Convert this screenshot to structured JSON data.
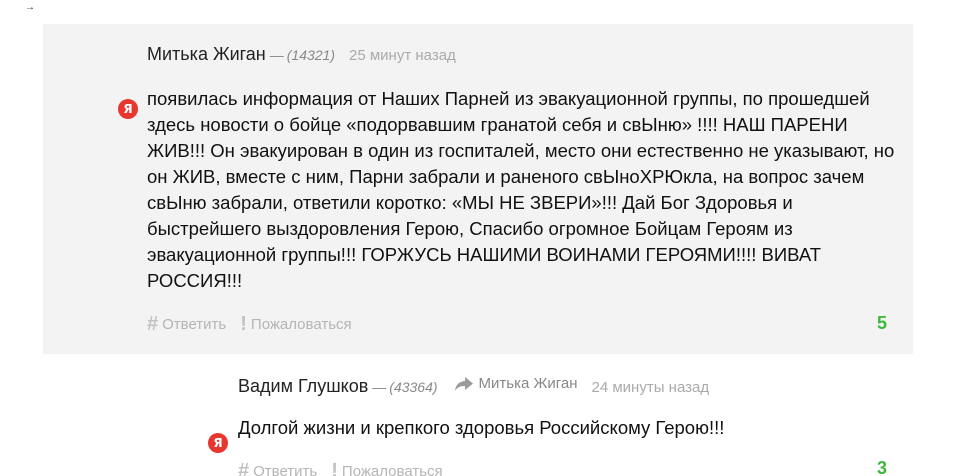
{
  "comment1": {
    "author": "Митька Жиган",
    "dash": "—",
    "karma": "(14321)",
    "time": "25 минут назад",
    "badge_letter": "Я",
    "badge_color": "#e8362f",
    "text": "  появилась информация от Наших Парней из эвакуационной группы, по прошедшей здесь новости о бойце «подорвавшим гранатой себя и свЫню» !!!! НАШ ПАРЕНИ ЖИВ!!! Он эвакуирован в один из госпиталей, место они естественно не указывают, но он ЖИВ, вместе с ним, Парни забрали и раненого свЫноХРЮкла, на вопрос зачем свЫню забрали, ответили коротко: «МЫ НЕ ЗВЕРИ»!!! Дай Бог Здоровья и быстрейшего выздоровления Герою, Спасибо огромное Бойцам Героям из эвакуационной группы!!! ГОРЖУСЬ НАШИМИ ВОИНАМИ ГЕРОЯМИ!!!! ВИВАТ РОССИЯ!!!",
    "reply_glyph": "#",
    "reply_label": "Ответить",
    "report_glyph": "!",
    "report_label": "Пожаловаться",
    "score": "5",
    "score_color": "#3cb83c"
  },
  "comment2": {
    "author": "Вадим Глушков",
    "dash": "—",
    "karma": "(43364)",
    "reply_to": "Митька Жиган",
    "reply_to_icon": "share-arrow-icon",
    "time": "24 минуты назад",
    "badge_letter": "Я",
    "text": "Долгой жизни и крепкого здоровья Российскому Герою!!!",
    "reply_glyph": "#",
    "reply_label": "Ответить",
    "report_glyph": "!",
    "report_label": "Пожаловаться",
    "score": "3"
  },
  "misc": {
    "corner_arrow": "→"
  }
}
